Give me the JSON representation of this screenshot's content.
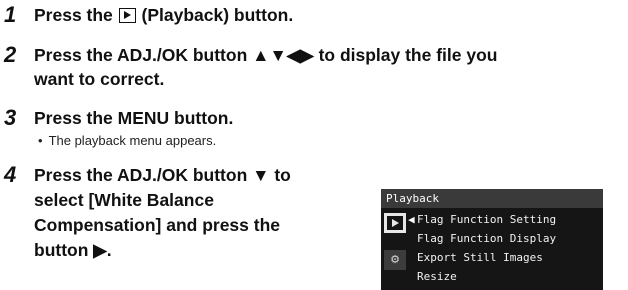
{
  "steps": [
    {
      "number": "1",
      "before_icon": "Press the ",
      "icon": "playback-icon",
      "after_icon": " (Playback) button."
    },
    {
      "number": "2",
      "line1_text": "Press the ADJ./OK button ",
      "line1_arrows": "▲▼◀▶",
      "line1_after": " to display the file you",
      "line2": "want to correct."
    },
    {
      "number": "3",
      "text": "Press the MENU button.",
      "bullet": "•",
      "sub": "The playback menu appears."
    },
    {
      "number": "4",
      "line1_text": "Press the ADJ./OK button ",
      "line1_arrow": "▼",
      "line1_after": " to",
      "line2": "select [White Balance",
      "line3": "Compensation] and press the",
      "line4_text": "button ",
      "line4_arrow": "▶",
      "line4_after": "."
    }
  ],
  "screen": {
    "header": "Playback",
    "caret": "◀",
    "setup_tab_label": "⚙",
    "items": [
      "Flag Function Setting",
      "Flag Function Display",
      "Export Still Images",
      "Resize"
    ]
  }
}
